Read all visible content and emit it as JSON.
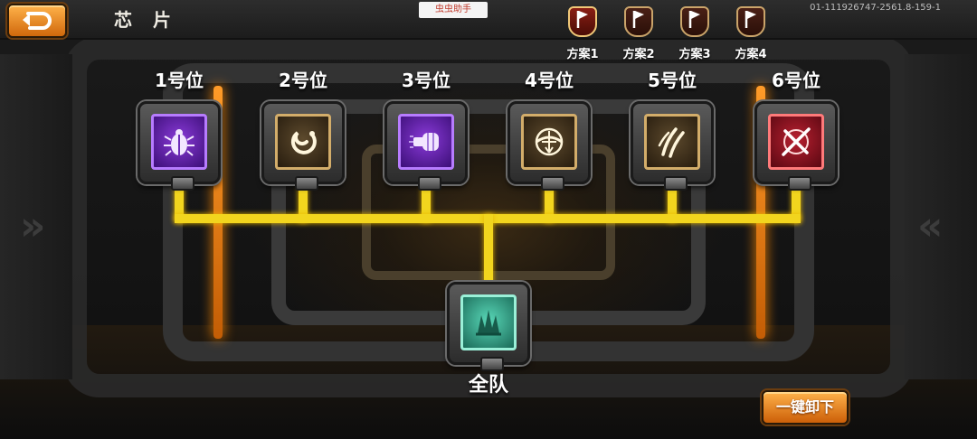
{
  "header": {
    "title": "芯 片",
    "back_icon": "return-arrow-icon",
    "watermark": "虫虫助手",
    "version": "01-111926747-2561.8-159-1"
  },
  "plans": [
    {
      "label": "方案1",
      "active": true,
      "icon": "flag-shield-icon"
    },
    {
      "label": "方案2",
      "active": false,
      "icon": "flag-shield-icon"
    },
    {
      "label": "方案3",
      "active": false,
      "icon": "flag-shield-icon"
    },
    {
      "label": "方案4",
      "active": false,
      "icon": "flag-shield-icon"
    }
  ],
  "slots": [
    {
      "label": "1号位",
      "color": "purple",
      "icon": "beetle-icon"
    },
    {
      "label": "2号位",
      "color": "gold",
      "icon": "swirl-icon"
    },
    {
      "label": "3号位",
      "color": "purple",
      "icon": "punch-fist-icon"
    },
    {
      "label": "4号位",
      "color": "gold",
      "icon": "crossbow-target-icon"
    },
    {
      "label": "5号位",
      "color": "gold",
      "icon": "claw-slash-icon"
    },
    {
      "label": "6号位",
      "color": "red",
      "icon": "crossed-swords-icon"
    }
  ],
  "team": {
    "label": "全队",
    "color": "teal",
    "icon": "spikes-crown-icon"
  },
  "actions": {
    "unload_all": "一键卸下"
  },
  "colors": {
    "accent": "#f2d51e",
    "button": "#e8891e",
    "purple": "#7a2ed0",
    "gold": "#c9a86a",
    "red": "#b82030",
    "teal": "#58d6b6"
  }
}
